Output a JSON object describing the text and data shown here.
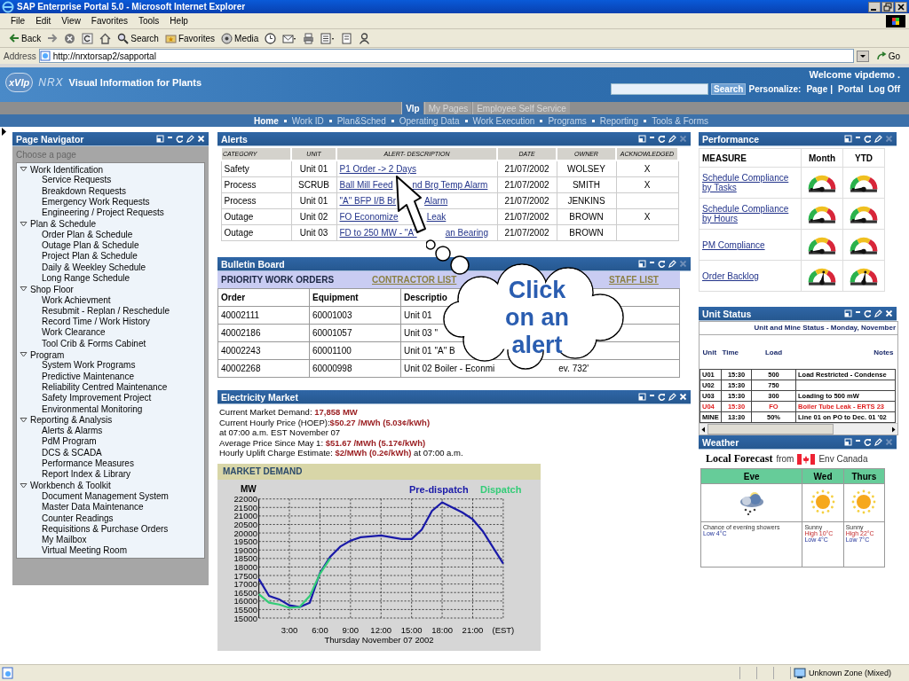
{
  "window": {
    "title": "SAP Enterprise Portal 5.0 - Microsoft Internet Explorer"
  },
  "menu": [
    "File",
    "Edit",
    "View",
    "Favorites",
    "Tools",
    "Help"
  ],
  "toolbar": [
    {
      "kind": "back",
      "label": "Back"
    },
    {
      "kind": "forward"
    },
    {
      "kind": "stop"
    },
    {
      "kind": "refresh"
    },
    {
      "kind": "home"
    },
    {
      "kind": "search",
      "label": "Search"
    },
    {
      "kind": "favorites",
      "label": "Favorites"
    },
    {
      "kind": "media",
      "label": "Media"
    },
    {
      "kind": "history"
    },
    {
      "kind": "mail"
    },
    {
      "kind": "print"
    },
    {
      "kind": "edit"
    },
    {
      "kind": "discuss"
    },
    {
      "kind": "messenger"
    }
  ],
  "address": {
    "label": "Address",
    "value": "http://nrxtorsap2/sapportal",
    "go": "Go"
  },
  "portal": {
    "logo": "xVIp",
    "brand": "NRX",
    "tagline": "Visual Information for Plants",
    "welcome": "Welcome vipdemo .",
    "search_button": "Search",
    "personalize": "Personalize:",
    "separator": "|",
    "links": [
      "Page",
      "Portal",
      "Log Off"
    ]
  },
  "tabs": [
    {
      "label": "Vlp",
      "selected": true
    },
    {
      "label": "My Pages",
      "selected": false
    },
    {
      "label": "Employee Self Service",
      "selected": false
    }
  ],
  "subnav": [
    {
      "label": "Home",
      "selected": true
    },
    {
      "label": "Work ID",
      "selected": false
    },
    {
      "label": "Plan&Sched",
      "selected": false
    },
    {
      "label": "Operating Data",
      "selected": false
    },
    {
      "label": "Work Execution",
      "selected": false
    },
    {
      "label": "Programs",
      "selected": false
    },
    {
      "label": "Reporting",
      "selected": false
    },
    {
      "label": "Tools & Forms",
      "selected": false
    }
  ],
  "navigator": {
    "title": "Page Navigator",
    "close_enabled": true,
    "hint": "Choose a page",
    "items": [
      {
        "label": "Work Identification",
        "expanded": true,
        "children": [
          {
            "label": "Service Requests"
          },
          {
            "label": "Breakdown Requests"
          },
          {
            "label": "Emergency Work Requests"
          },
          {
            "label": "Engineering / Project Requests"
          }
        ]
      },
      {
        "label": "Plan & Schedule",
        "expanded": true,
        "children": [
          {
            "label": "Order Plan & Schedule"
          },
          {
            "label": "Outage Plan & Schedule"
          },
          {
            "label": "Project Plan & Schedule"
          },
          {
            "label": "Daily & Weekley Schedule"
          },
          {
            "label": "Long Range Schedule"
          }
        ]
      },
      {
        "label": "Shop Floor",
        "expanded": true,
        "children": [
          {
            "label": "Work Achievment"
          },
          {
            "label": "Resubmit - Replan / Reschedule"
          },
          {
            "label": "Record Time / Work History"
          },
          {
            "label": "Work Clearance"
          },
          {
            "label": "Tool Crib & Forms Cabinet"
          }
        ]
      },
      {
        "label": "Program",
        "expanded": true,
        "children": [
          {
            "label": "System Work Programs"
          },
          {
            "label": "Predictive Maintenance"
          },
          {
            "label": "Reliability Centred Maintenance"
          },
          {
            "label": "Safety Improvement Project"
          },
          {
            "label": "Environmental Monitoring"
          }
        ]
      },
      {
        "label": "Reporting & Analysis",
        "expanded": true,
        "children": [
          {
            "label": "Alerts & Alarms"
          },
          {
            "label": "PdM Program"
          },
          {
            "label": "DCS & SCADA"
          },
          {
            "label": "Performance Measures"
          },
          {
            "label": "Report Index & Library"
          }
        ]
      },
      {
        "label": "Workbench & Toolkit",
        "expanded": true,
        "children": [
          {
            "label": "Document Management System"
          },
          {
            "label": "Master Data Maintenance"
          },
          {
            "label": "Counter Readings"
          },
          {
            "label": "Requisitions & Purchase Orders"
          },
          {
            "label": "My Mailbox"
          },
          {
            "label": "Virtual Meeting Room"
          }
        ]
      }
    ]
  },
  "alerts": {
    "title": "Alerts",
    "close_enabled": false,
    "columns": [
      "CATEGORY",
      "UNIT",
      "ALERT- DESCRIPTION",
      "DATE",
      "OWNER",
      "ACKNOWLEDGED"
    ],
    "rows": [
      {
        "category": "Safety",
        "unit": "Unit 01",
        "description": [
          "P1 Order -> 2 Days"
        ],
        "date": "21/07/2002",
        "owner": "WOLSEY",
        "acknowledged": "X"
      },
      {
        "category": "Process",
        "unit": "SCRUB",
        "description": [
          "Ball Mill Feed",
          "nd Brg Temp Alarm"
        ],
        "date": "21/07/2002",
        "owner": "SMITH",
        "acknowledged": "X"
      },
      {
        "category": "Process",
        "unit": "Unit 01",
        "description": [
          "\"A\" BFP I/B Br",
          "Alarm"
        ],
        "date": "21/07/2002",
        "owner": "JENKINS"
      },
      {
        "category": "Outage",
        "unit": "Unit 02",
        "description": [
          "FO Economize",
          "Leak"
        ],
        "date": "21/07/2002",
        "owner": "BROWN",
        "acknowledged": "X"
      },
      {
        "category": "Outage",
        "unit": "Unit 03",
        "description": [
          "FD to 250 MW - \"A\"",
          "an Bearing"
        ],
        "date": "21/07/2002",
        "owner": "BROWN"
      }
    ]
  },
  "bulletin": {
    "title": "Bulletin Board",
    "close_enabled": false,
    "tabs": [
      {
        "label": "PRIORITY WORK ORDERS",
        "selected": true
      },
      {
        "label": "CONTRACTOR LIST",
        "selected": false
      },
      {
        "label": "STAFF LIST",
        "selected": false
      }
    ],
    "columns": [
      "Order",
      "Equipment",
      "Descriptio"
    ],
    "rows": [
      {
        "order": "40002111",
        "equipment": "60001003",
        "description": [
          "Unit 01"
        ]
      },
      {
        "order": "40002186",
        "equipment": "60001057",
        "description": [
          "Unit 03 \""
        ]
      },
      {
        "order": "40002243",
        "equipment": "60001100",
        "description": [
          "Unit 01 \"A\" B"
        ]
      },
      {
        "order": "40002268",
        "equipment": "60000998",
        "description": [
          "Unit 02 Boiler - Econmi",
          "ev. 732'"
        ]
      }
    ]
  },
  "electricity": {
    "title": "Electricity Market",
    "close_enabled": true,
    "lines": [
      "Current Market Demand: **17,858 MW**",
      "Current Hourly Price (HOEP):**$50.27 /MWh (5.03¢/kWh)**",
      "at 07:00 a.m. EST November 07",
      "Average Price Since May 1: **$51.67 /MWh (5.17¢/kWh)**",
      "Hourly Uplift Charge Estimate: **$2/MWh (0.2¢/kWh)** at 07:00 a.m."
    ],
    "market": {
      "title": "MARKET DEMAND",
      "chart_data": {
        "type": "line",
        "grid": true,
        "xlabel": "Thursday November 07 2002",
        "ylabel": "MW",
        "x": [
          0,
          1,
          2,
          3,
          4,
          5,
          6,
          7,
          8,
          9,
          10,
          11,
          12,
          13,
          14,
          15,
          16,
          17,
          18,
          19,
          20,
          21,
          22,
          23,
          24
        ],
        "xlim": [
          0,
          24
        ],
        "ylim": [
          15000,
          22000
        ],
        "xticks": [
          {
            "value": 3,
            "label": "3:00"
          },
          {
            "value": 6,
            "label": "6:00"
          },
          {
            "value": 9,
            "label": "9:00"
          },
          {
            "value": 12,
            "label": "12:00"
          },
          {
            "value": 15,
            "label": "15:00"
          },
          {
            "value": 18,
            "label": "18:00"
          },
          {
            "value": 21,
            "label": "21:00"
          },
          {
            "value": 24,
            "label": "(EST)"
          }
        ],
        "yticks": [
          15000,
          15500,
          16000,
          16500,
          17000,
          17500,
          18000,
          18500,
          19000,
          19500,
          20000,
          20500,
          21000,
          21500,
          22000
        ],
        "series": [
          {
            "name": "Pre-dispatch",
            "color": "#1a1aa8",
            "values": [
              17300,
              16300,
              16100,
              15750,
              15650,
              15900,
              17650,
              18600,
              19200,
              19550,
              19750,
              19800,
              19850,
              19750,
              19650,
              19650,
              20200,
              21300,
              21800,
              21500,
              21200,
              20800,
              20100,
              19150,
              18200
            ]
          },
          {
            "name": "Dispatch",
            "color": "#33cc77",
            "values": [
              16400,
              15900,
              15800,
              15600,
              15650,
              16300,
              17600,
              18500,
              null,
              null,
              null,
              null,
              null,
              null,
              null,
              null,
              null,
              null,
              null,
              null,
              null,
              null,
              null,
              null,
              null
            ]
          }
        ]
      }
    }
  },
  "performance": {
    "title": "Performance",
    "close_enabled": false,
    "columns": [
      "MEASURE",
      "Month",
      "YTD"
    ],
    "rows": [
      {
        "measure": "Schedule Compliance by Tasks",
        "gauges": [
          {
            "level": 0
          },
          {
            "level": 0
          }
        ]
      },
      {
        "measure": "Schedule Compliance by Hours",
        "gauges": [
          {
            "level": 0
          },
          {
            "level": 0
          }
        ]
      },
      {
        "measure": "PM Compliance",
        "gauges": [
          {
            "level": 0
          },
          {
            "level": 0
          }
        ]
      },
      {
        "measure": "Order Backlog",
        "gauges": [
          {
            "level": 0.55
          },
          {
            "level": 0.55
          }
        ]
      }
    ]
  },
  "unit_status": {
    "title": "Unit Status",
    "close_enabled": true,
    "caption": "Unit and Mine Status - Monday, November",
    "columns": [
      "Unit",
      "Time",
      "Load",
      "Notes"
    ],
    "rows": [
      {
        "unit": "U01",
        "time": "15:30",
        "load": "500",
        "notes": "Load Restricted - Condense",
        "alarm": false
      },
      {
        "unit": "U02",
        "time": "15:30",
        "load": "750",
        "alarm": false
      },
      {
        "unit": "U03",
        "time": "15:30",
        "load": "300",
        "notes": "Loading to 500 mW",
        "alarm": false
      },
      {
        "unit": "U04",
        "time": "15:30",
        "load": "FO",
        "notes": "Boiler Tube Leak - ERTS 23",
        "alarm": true
      },
      {
        "unit": "MINE",
        "time": "13:30",
        "load": "50%",
        "notes": "Line 01 on PO to Dec. 01 '02",
        "alarm": false
      }
    ]
  },
  "weather": {
    "title": "Weather",
    "close_enabled": false,
    "heading": "Local Forecast",
    "from": "from",
    "source": "Env Canada",
    "days": [
      {
        "label": "Eve",
        "kind": "showers",
        "summary": "Chance of evening showers",
        "low": "Low 4°C"
      },
      {
        "label": "Wed",
        "kind": "sunny",
        "summary": "Sunny",
        "high": "High 10°C",
        "low": "Low 4°C"
      },
      {
        "label": "Thurs",
        "kind": "sunny",
        "summary": "Sunny",
        "high": "High 22°C",
        "low": "Low 7°C"
      }
    ]
  },
  "callout": {
    "text": "Click on an alert"
  },
  "status_bar": {
    "zone": "Unknown Zone (Mixed)"
  }
}
